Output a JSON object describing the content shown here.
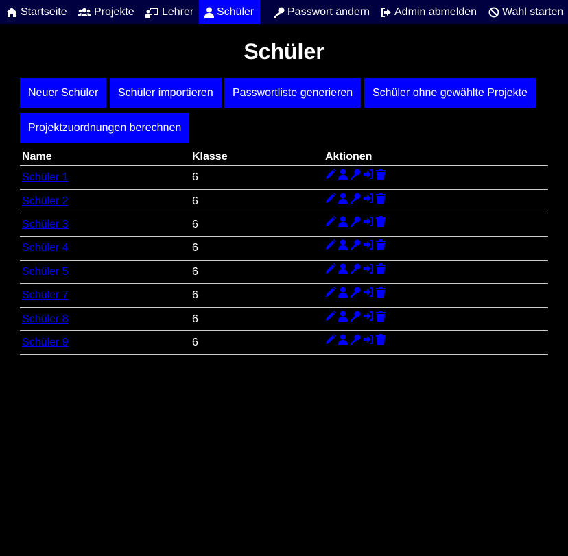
{
  "nav": {
    "home_label": "Startseite",
    "projects_label": "Projekte",
    "teachers_label": "Lehrer",
    "students_label": "Schüler",
    "password_label": "Passwort ändern",
    "logout_label": "Admin abmelden",
    "vote_label": "Wahl starten"
  },
  "page": {
    "title": "Schüler"
  },
  "toolbar": {
    "new_student": "Neuer Schüler",
    "import_students": "Schüler importieren",
    "password_list": "Passwortliste generieren",
    "students_without_projects": "Schüler ohne gewählte Projekte",
    "calc_assignments": "Projektzuordnungen berechnen"
  },
  "table": {
    "headers": [
      "Name",
      "Klasse",
      "Aktionen"
    ],
    "rows": [
      {
        "name": "Schüler 1",
        "klasse": "6"
      },
      {
        "name": "Schüler 2",
        "klasse": "6"
      },
      {
        "name": "Schüler 3",
        "klasse": "6"
      },
      {
        "name": "Schüler 4",
        "klasse": "6"
      },
      {
        "name": "Schüler 5",
        "klasse": "6"
      },
      {
        "name": "Schüler 7",
        "klasse": "6"
      },
      {
        "name": "Schüler 8",
        "klasse": "6"
      },
      {
        "name": "Schüler 9",
        "klasse": "6"
      }
    ],
    "action_icons": [
      "pencil-icon",
      "user-icon",
      "key-icon",
      "sign-in-icon",
      "trash-icon"
    ]
  },
  "colors": {
    "nav_bg": "#000040",
    "accent": "#0000ff",
    "link": "#0000ee",
    "background": "#000000"
  }
}
